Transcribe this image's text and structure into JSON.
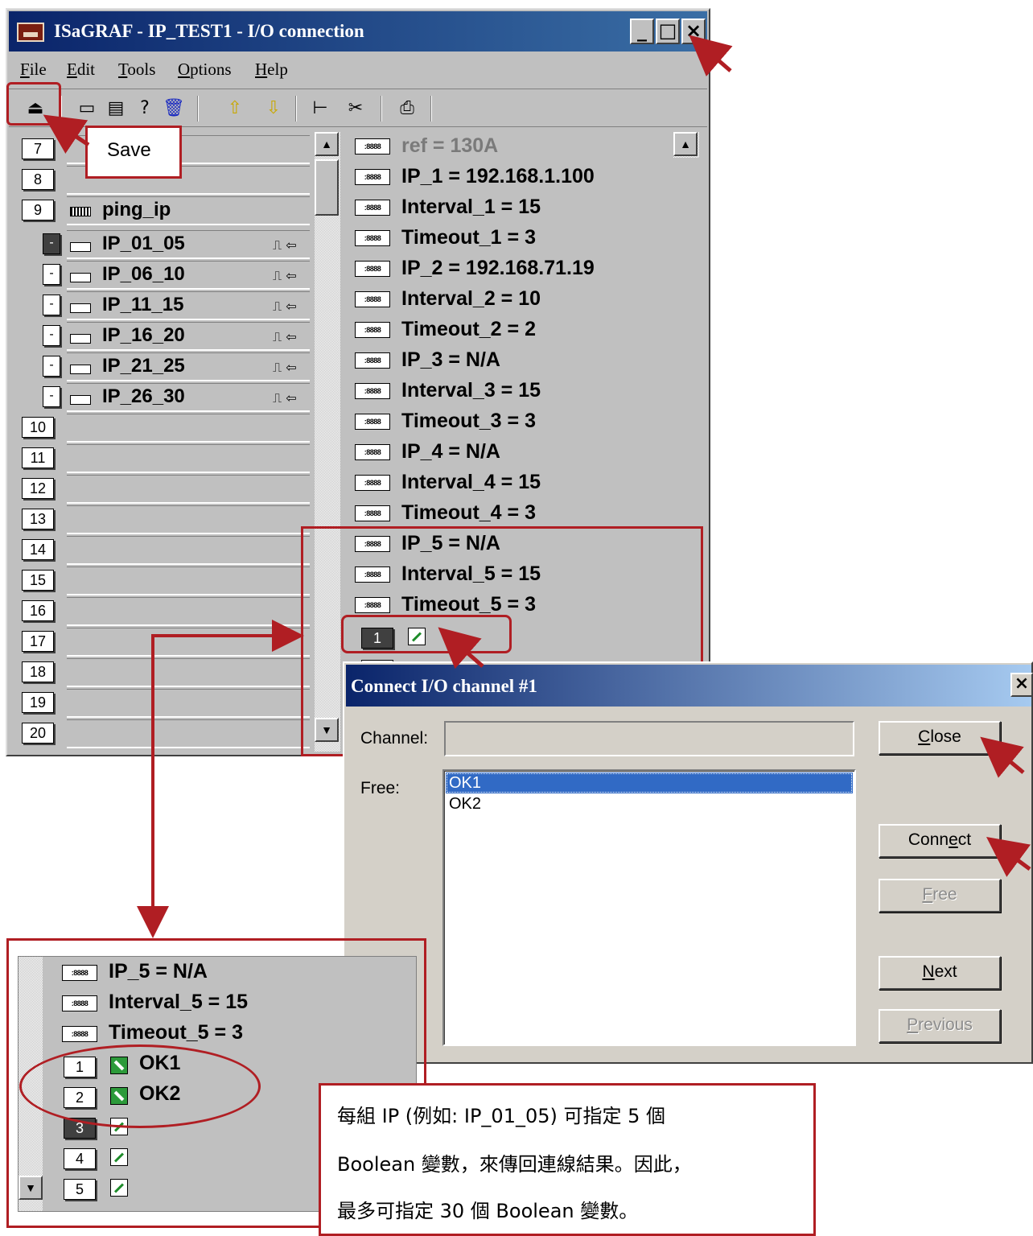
{
  "window": {
    "title": "ISaGRAF - IP_TEST1 - I/O connection",
    "controls": {
      "minimize": "_",
      "maximize": "□",
      "close": "×"
    }
  },
  "menu": [
    {
      "pre": "",
      "u": "F",
      "post": "ile"
    },
    {
      "pre": "",
      "u": "E",
      "post": "dit"
    },
    {
      "pre": "",
      "u": "T",
      "post": "ools"
    },
    {
      "pre": "",
      "u": "O",
      "post": "ptions"
    },
    {
      "pre": "",
      "u": "H",
      "post": "elp"
    }
  ],
  "toolbar": {
    "icons": [
      "save-icon",
      "board-icon",
      "board-info-icon",
      "board-help-icon",
      "trash-icon",
      "arrow-up-icon",
      "arrow-down-icon",
      "tree-icon",
      "cut-icon",
      "print-icon"
    ],
    "glyphs": [
      "⏏",
      "▭",
      "▤",
      "?",
      "🗑",
      "⇧",
      "⇩",
      "⊢",
      "✂",
      "⎙"
    ],
    "save_callout": "Save"
  },
  "left_rows": [
    {
      "num": "7",
      "label": ""
    },
    {
      "num": "8",
      "label": ""
    },
    {
      "num": "9",
      "label": "ping_ip"
    }
  ],
  "sub_rows": [
    {
      "mark": "-",
      "label": "IP_01_05",
      "pulse": "⎍ ⇦",
      "dark": true
    },
    {
      "mark": "-",
      "label": "IP_06_10",
      "pulse": "⎍ ⇦"
    },
    {
      "mark": "-",
      "label": "IP_11_15",
      "pulse": "⎍ ⇦"
    },
    {
      "mark": "-",
      "label": "IP_16_20",
      "pulse": "⎍ ⇦"
    },
    {
      "mark": "-",
      "label": "IP_21_25",
      "pulse": "⎍ ⇦"
    },
    {
      "mark": "-",
      "label": "IP_26_30",
      "pulse": "⎍ ⇦"
    }
  ],
  "empty_rows": [
    "10",
    "11",
    "12",
    "13",
    "14",
    "15",
    "16",
    "17",
    "18",
    "19",
    "20"
  ],
  "params": [
    {
      "text": "ref = 130A",
      "gray": true
    },
    {
      "text": "IP_1 = 192.168.1.100"
    },
    {
      "text": "Interval_1 = 15"
    },
    {
      "text": "Timeout_1 = 3"
    },
    {
      "text": "IP_2 = 192.168.71.19"
    },
    {
      "text": "Interval_2 = 10"
    },
    {
      "text": "Timeout_2 = 2"
    },
    {
      "text": "IP_3 = N/A"
    },
    {
      "text": "Interval_3 = 15"
    },
    {
      "text": "Timeout_3 = 3"
    },
    {
      "text": "IP_4 = N/A"
    },
    {
      "text": "Interval_4 = 15"
    },
    {
      "text": "Timeout_4 = 3"
    },
    {
      "text": "IP_5 = N/A"
    },
    {
      "text": "Interval_5 = 15"
    },
    {
      "text": "Timeout_5 = 3"
    }
  ],
  "param_icon_text": ":8888",
  "channel_row": {
    "num": "1"
  },
  "dialog": {
    "title": "Connect I/O channel #1",
    "close_glyph": "×",
    "channel_label": "Channel:",
    "channel_value": "",
    "free_label": "Free:",
    "free_items": [
      "OK1",
      "OK2"
    ],
    "buttons": {
      "close": {
        "pre": "",
        "u": "C",
        "post": "lose"
      },
      "connect": {
        "pre": "Conn",
        "u": "e",
        "post": "ct"
      },
      "free": {
        "pre": "",
        "u": "F",
        "post": "ree"
      },
      "next": {
        "pre": "",
        "u": "N",
        "post": "ext"
      },
      "previous": {
        "pre": "",
        "u": "P",
        "post": "revious"
      }
    }
  },
  "zoom": {
    "params": [
      "IP_5 = N/A",
      "Interval_5 = 15",
      "Timeout_5 = 3"
    ],
    "channels": [
      {
        "num": "1",
        "label": "OK1",
        "connected": true
      },
      {
        "num": "2",
        "label": "OK2",
        "connected": true
      },
      {
        "num": "3",
        "label": "",
        "connected": false,
        "dark": true
      },
      {
        "num": "4",
        "label": "",
        "connected": false
      },
      {
        "num": "5",
        "label": "",
        "connected": false
      }
    ]
  },
  "note": {
    "line1": "每組 IP (例如: IP_01_05) 可指定 5 個",
    "line2": "Boolean 變數，來傳回連線結果。因此，",
    "line3": "最多可指定 30 個 Boolean 變數。"
  },
  "colors": {
    "annotation_red": "#b01e23",
    "title_blue": "#0a246a",
    "selection_blue": "#316ac5"
  }
}
